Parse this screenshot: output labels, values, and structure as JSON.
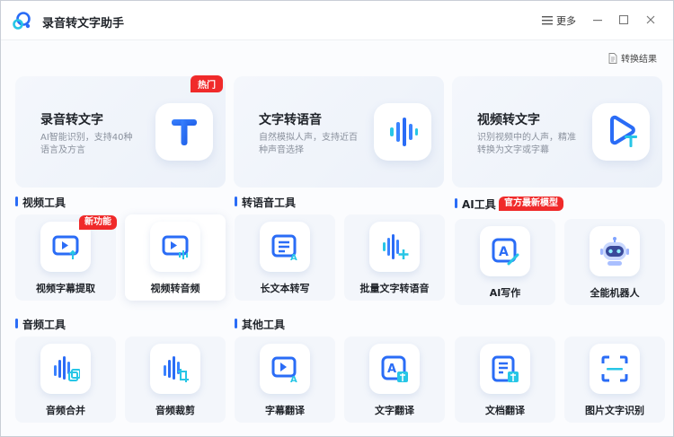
{
  "app": {
    "title": "录音转文字助手"
  },
  "header": {
    "more_label": "更多",
    "convert_result_label": "转换结果"
  },
  "features": [
    {
      "title": "录音转文字",
      "desc": "AI智能识别，支持40种语言及方言",
      "badge": "热门",
      "icon": "T-text-icon"
    },
    {
      "title": "文字转语音",
      "desc": "自然模拟人声，支持近百种声音选择",
      "icon": "waveform-icon"
    },
    {
      "title": "视频转文字",
      "desc": "识别视频中的人声，精准转换为文字或字幕",
      "icon": "video-text-icon"
    }
  ],
  "sections": {
    "video": {
      "title": "视频工具",
      "badge": "新功能",
      "items": [
        "视频字幕提取",
        "视频转音频"
      ]
    },
    "speech": {
      "title": "转语音工具",
      "items": [
        "长文本转写",
        "批量文字转语音"
      ]
    },
    "ai": {
      "title": "AI工具",
      "badge": "官方最新模型",
      "items": [
        "AI写作",
        "全能机器人"
      ]
    },
    "audio": {
      "title": "音频工具",
      "items": [
        "音频合并",
        "音频裁剪"
      ]
    },
    "other": {
      "title": "其他工具",
      "items": [
        "字幕翻译",
        "文字翻译",
        "文档翻译",
        "图片文字识别"
      ]
    }
  },
  "colors": {
    "accent": "#2a6cf6",
    "badge_red": "#f02a2a",
    "icon_cyan": "#27c6e6"
  }
}
